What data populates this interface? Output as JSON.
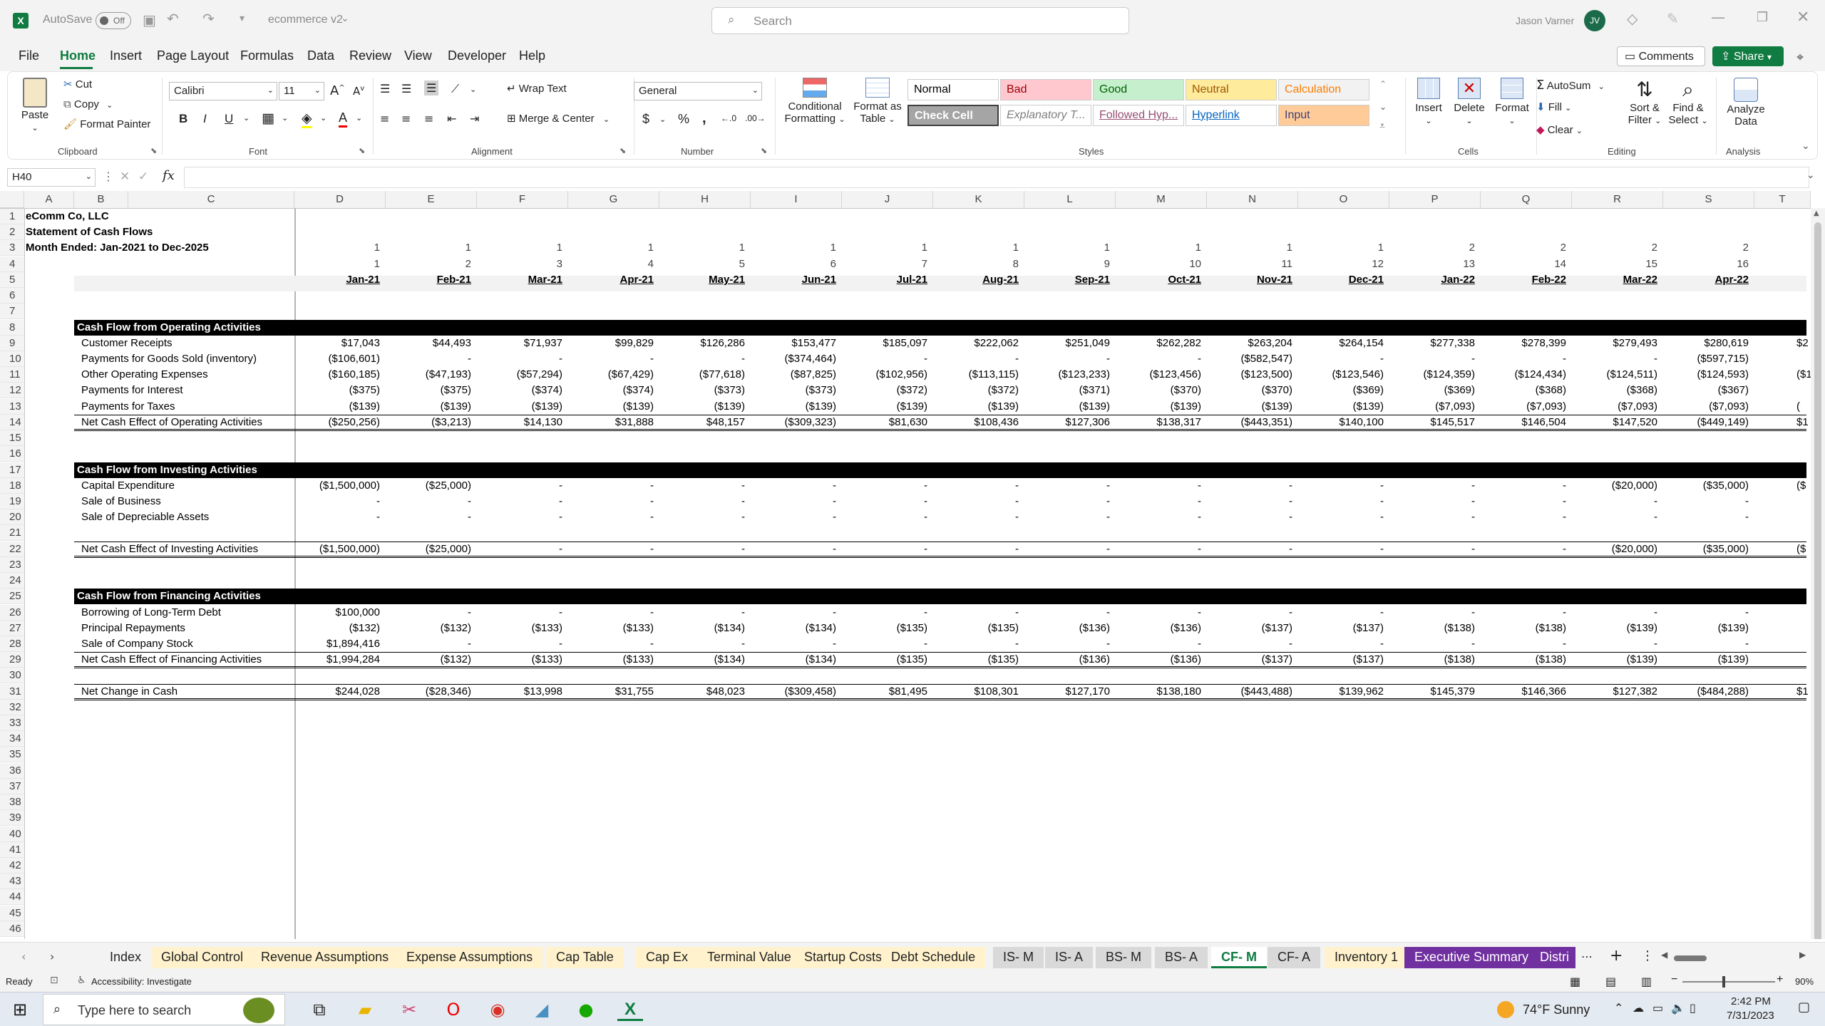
{
  "titlebar": {
    "autosave": "AutoSave",
    "autosave_state": "Off",
    "filename": "ecommerce v2",
    "search_placeholder": "Search",
    "user": "Jason Varner",
    "user_initials": "JV"
  },
  "menu": [
    "File",
    "Home",
    "Insert",
    "Page Layout",
    "Formulas",
    "Data",
    "Review",
    "View",
    "Developer",
    "Help"
  ],
  "menu_active": "Home",
  "comments": "Comments",
  "share": "Share",
  "ribbon": {
    "clipboard": {
      "paste": "Paste",
      "cut": "Cut",
      "copy": "Copy",
      "format_painter": "Format Painter",
      "label": "Clipboard"
    },
    "font": {
      "name": "Calibri",
      "size": "11",
      "label": "Font"
    },
    "alignment": {
      "wrap": "Wrap Text",
      "merge": "Merge & Center",
      "label": "Alignment"
    },
    "number": {
      "format": "General",
      "label": "Number"
    },
    "styles": {
      "cond1": "Conditional",
      "cond2": "Formatting",
      "fmt1": "Format as",
      "fmt2": "Table",
      "label": "Styles",
      "cells": [
        {
          "t": "Normal",
          "bg": "#ffffff",
          "fg": "#000000"
        },
        {
          "t": "Bad",
          "bg": "#ffc7ce",
          "fg": "#9c0006"
        },
        {
          "t": "Good",
          "bg": "#c6efce",
          "fg": "#006100"
        },
        {
          "t": "Neutral",
          "bg": "#ffeb9c",
          "fg": "#9c5700"
        },
        {
          "t": "Calculation",
          "bg": "#f2f2f2",
          "fg": "#fa7d00"
        },
        {
          "t": "Check Cell",
          "bg": "#a5a5a5",
          "fg": "#ffffff"
        },
        {
          "t": "Explanatory T...",
          "bg": "#ffffff",
          "fg": "#7f7f7f"
        },
        {
          "t": "Followed Hyp...",
          "bg": "#ffffff",
          "fg": "#954f72"
        },
        {
          "t": "Hyperlink",
          "bg": "#ffffff",
          "fg": "#0563c1"
        },
        {
          "t": "Input",
          "bg": "#ffcc99",
          "fg": "#3f3f76"
        }
      ]
    },
    "cells": {
      "insert": "Insert",
      "delete": "Delete",
      "format": "Format",
      "label": "Cells"
    },
    "editing": {
      "autosum": "AutoSum",
      "fill": "Fill",
      "clear": "Clear",
      "sort1": "Sort &",
      "sort2": "Filter",
      "find1": "Find &",
      "find2": "Select",
      "label": "Editing"
    },
    "analysis": {
      "a1": "Analyze",
      "a2": "Data",
      "label": "Analysis"
    }
  },
  "namebox": "H40",
  "columns": [
    "A",
    "B",
    "C",
    "D",
    "E",
    "F",
    "G",
    "H",
    "I",
    "J",
    "K",
    "L",
    "M",
    "N",
    "O",
    "P",
    "Q",
    "R",
    "S",
    "T"
  ],
  "company": "eComm Co, LLC",
  "statement": "Statement of Cash Flows",
  "period": "Month Ended: Jan-2021 to Dec-2025",
  "row3": [
    "1",
    "1",
    "1",
    "1",
    "1",
    "1",
    "1",
    "1",
    "1",
    "1",
    "1",
    "1",
    "2",
    "2",
    "2",
    "2"
  ],
  "row4": [
    "1",
    "2",
    "3",
    "4",
    "5",
    "6",
    "7",
    "8",
    "9",
    "10",
    "11",
    "12",
    "13",
    "14",
    "15",
    "16"
  ],
  "months": [
    "Jan-21",
    "Feb-21",
    "Mar-21",
    "Apr-21",
    "May-21",
    "Jun-21",
    "Jul-21",
    "Aug-21",
    "Sep-21",
    "Oct-21",
    "Nov-21",
    "Dec-21",
    "Jan-22",
    "Feb-22",
    "Mar-22",
    "Apr-22"
  ],
  "sections": {
    "operating": {
      "title": "Cash Flow from Operating Activities",
      "rows": [
        {
          "label": "Customer Receipts",
          "v": [
            "$17,043",
            "$44,493",
            "$71,937",
            "$99,829",
            "$126,286",
            "$153,477",
            "$185,097",
            "$222,062",
            "$251,049",
            "$262,282",
            "$263,204",
            "$264,154",
            "$277,338",
            "$278,399",
            "$279,493",
            "$280,619",
            "$2"
          ]
        },
        {
          "label": "Payments for Goods Sold (inventory)",
          "v": [
            "($106,601)",
            "-",
            "-",
            "-",
            "-",
            "($374,464)",
            "-",
            "-",
            "-",
            "-",
            "($582,547)",
            "-",
            "-",
            "-",
            "-",
            "($597,715)",
            ""
          ]
        },
        {
          "label": "Other Operating Expenses",
          "v": [
            "($160,185)",
            "($47,193)",
            "($57,294)",
            "($67,429)",
            "($77,618)",
            "($87,825)",
            "($102,956)",
            "($113,115)",
            "($123,233)",
            "($123,456)",
            "($123,500)",
            "($123,546)",
            "($124,359)",
            "($124,434)",
            "($124,511)",
            "($124,593)",
            "($1"
          ]
        },
        {
          "label": "Payments for Interest",
          "v": [
            "($375)",
            "($375)",
            "($374)",
            "($374)",
            "($373)",
            "($373)",
            "($372)",
            "($372)",
            "($371)",
            "($370)",
            "($370)",
            "($369)",
            "($369)",
            "($368)",
            "($368)",
            "($367)",
            ""
          ]
        },
        {
          "label": "Payments for Taxes",
          "v": [
            "($139)",
            "($139)",
            "($139)",
            "($139)",
            "($139)",
            "($139)",
            "($139)",
            "($139)",
            "($139)",
            "($139)",
            "($139)",
            "($139)",
            "($7,093)",
            "($7,093)",
            "($7,093)",
            "($7,093)",
            "("
          ]
        }
      ],
      "total": {
        "label": "Net Cash Effect of Operating Activities",
        "v": [
          "($250,256)",
          "($3,213)",
          "$14,130",
          "$31,888",
          "$48,157",
          "($309,323)",
          "$81,630",
          "$108,436",
          "$127,306",
          "$138,317",
          "($443,351)",
          "$140,100",
          "$145,517",
          "$146,504",
          "$147,520",
          "($449,149)",
          "$1"
        ]
      }
    },
    "investing": {
      "title": "Cash Flow from Investing Activities",
      "rows": [
        {
          "label": "Capital Expenditure",
          "v": [
            "($1,500,000)",
            "($25,000)",
            "-",
            "-",
            "-",
            "-",
            "-",
            "-",
            "-",
            "-",
            "-",
            "-",
            "-",
            "-",
            "($20,000)",
            "($35,000)",
            "($"
          ]
        },
        {
          "label": "Sale of Business",
          "v": [
            "-",
            "-",
            "-",
            "-",
            "-",
            "-",
            "-",
            "-",
            "-",
            "-",
            "-",
            "-",
            "-",
            "-",
            "-",
            "-",
            ""
          ]
        },
        {
          "label": "Sale of Depreciable Assets",
          "v": [
            "-",
            "-",
            "-",
            "-",
            "-",
            "-",
            "-",
            "-",
            "-",
            "-",
            "-",
            "-",
            "-",
            "-",
            "-",
            "-",
            ""
          ]
        }
      ],
      "total": {
        "label": "Net Cash Effect of Investing Activities",
        "v": [
          "($1,500,000)",
          "($25,000)",
          "-",
          "-",
          "-",
          "-",
          "-",
          "-",
          "-",
          "-",
          "-",
          "-",
          "-",
          "-",
          "($20,000)",
          "($35,000)",
          "($"
        ]
      }
    },
    "financing": {
      "title": "Cash Flow from Financing Activities",
      "rows": [
        {
          "label": "Borrowing of Long-Term Debt",
          "v": [
            "$100,000",
            "-",
            "-",
            "-",
            "-",
            "-",
            "-",
            "-",
            "-",
            "-",
            "-",
            "-",
            "-",
            "-",
            "-",
            "-",
            ""
          ]
        },
        {
          "label": "Principal Repayments",
          "v": [
            "($132)",
            "($132)",
            "($133)",
            "($133)",
            "($134)",
            "($134)",
            "($135)",
            "($135)",
            "($136)",
            "($136)",
            "($137)",
            "($137)",
            "($138)",
            "($138)",
            "($139)",
            "($139)",
            ""
          ]
        },
        {
          "label": "Sale of Company Stock",
          "v": [
            "$1,894,416",
            "-",
            "-",
            "-",
            "-",
            "-",
            "-",
            "-",
            "-",
            "-",
            "-",
            "-",
            "-",
            "-",
            "-",
            "-",
            ""
          ]
        }
      ],
      "total": {
        "label": "Net Cash Effect of Financing Activities",
        "v": [
          "$1,994,284",
          "($132)",
          "($133)",
          "($133)",
          "($134)",
          "($134)",
          "($135)",
          "($135)",
          "($136)",
          "($136)",
          "($137)",
          "($137)",
          "($138)",
          "($138)",
          "($139)",
          "($139)",
          ""
        ]
      }
    }
  },
  "net_change": {
    "label": "Net Change in Cash",
    "v": [
      "$244,028",
      "($28,346)",
      "$13,998",
      "$31,755",
      "$48,023",
      "($309,458)",
      "$81,495",
      "$108,301",
      "$127,170",
      "$138,180",
      "($443,488)",
      "$139,962",
      "$145,379",
      "$146,366",
      "$127,382",
      "($484,288)",
      "$1"
    ]
  },
  "sheets": [
    {
      "n": "Index",
      "bg": "#f3f3f3",
      "fg": "#222"
    },
    {
      "n": "Global Control",
      "bg": "#fff2cc",
      "fg": "#222"
    },
    {
      "n": "Revenue Assumptions",
      "bg": "#fff2cc",
      "fg": "#222"
    },
    {
      "n": "Expense Assumptions",
      "bg": "#fff2cc",
      "fg": "#222"
    },
    {
      "n": "Cap Table",
      "bg": "#fff2cc",
      "fg": "#222"
    },
    {
      "n": "Cap Ex",
      "bg": "#fff2cc",
      "fg": "#222"
    },
    {
      "n": "Terminal Value",
      "bg": "#fff2cc",
      "fg": "#222"
    },
    {
      "n": "Startup Costs",
      "bg": "#fff2cc",
      "fg": "#222"
    },
    {
      "n": "Debt Schedule",
      "bg": "#fff2cc",
      "fg": "#222"
    },
    {
      "n": "IS- M",
      "bg": "#d9d9d9",
      "fg": "#222"
    },
    {
      "n": "IS- A",
      "bg": "#d9d9d9",
      "fg": "#222"
    },
    {
      "n": "BS- M",
      "bg": "#d9d9d9",
      "fg": "#222"
    },
    {
      "n": "BS- A",
      "bg": "#d9d9d9",
      "fg": "#222"
    },
    {
      "n": "CF- M",
      "bg": "#ffffff",
      "fg": "#107c41"
    },
    {
      "n": "CF- A",
      "bg": "#d9d9d9",
      "fg": "#222"
    },
    {
      "n": "Inventory 1",
      "bg": "#fff2cc",
      "fg": "#222"
    },
    {
      "n": "Executive Summary",
      "bg": "#7030a0",
      "fg": "#ffffff"
    },
    {
      "n": "Distri",
      "bg": "#7030a0",
      "fg": "#ffffff"
    }
  ],
  "status": {
    "ready": "Ready",
    "accessibility": "Accessibility: Investigate",
    "zoom": "90%"
  },
  "taskbar": {
    "search": "Type here to search",
    "weather": "74°F  Sunny",
    "time": "2:42 PM",
    "date": "7/31/2023"
  }
}
